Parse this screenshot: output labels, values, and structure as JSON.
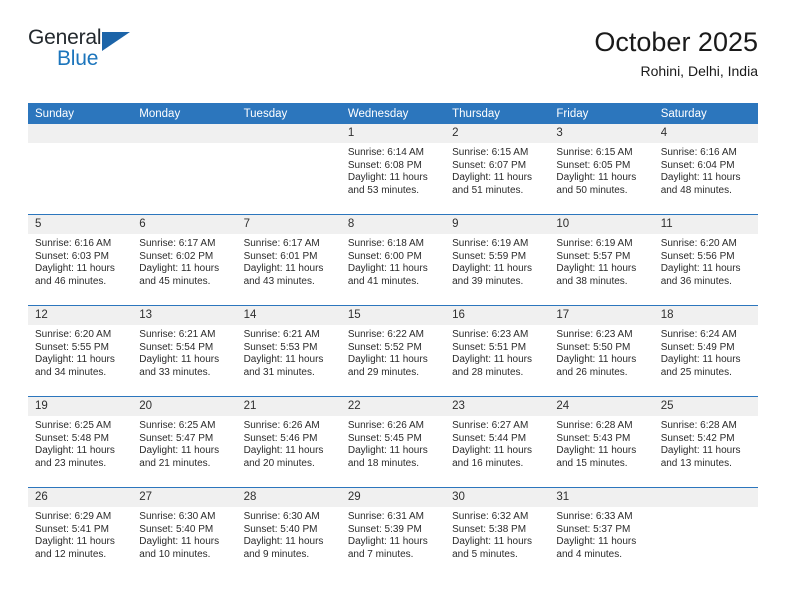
{
  "logo": {
    "word_top": "General",
    "word_bottom": "Blue",
    "triangle_color": "#1c64a8"
  },
  "header": {
    "title": "October 2025",
    "location": "Rohini, Delhi, India"
  },
  "theme": {
    "header_blue": "#2c76bd",
    "daynum_gray": "#f0f0f0"
  },
  "weekday_headers": [
    "Sunday",
    "Monday",
    "Tuesday",
    "Wednesday",
    "Thursday",
    "Friday",
    "Saturday"
  ],
  "weeks": [
    [
      {
        "day": "",
        "sunrise": "",
        "sunset": "",
        "daylight_line1": "",
        "daylight_line2": "",
        "empty": true
      },
      {
        "day": "",
        "sunrise": "",
        "sunset": "",
        "daylight_line1": "",
        "daylight_line2": "",
        "empty": true
      },
      {
        "day": "",
        "sunrise": "",
        "sunset": "",
        "daylight_line1": "",
        "daylight_line2": "",
        "empty": true
      },
      {
        "day": "1",
        "sunrise": "Sunrise: 6:14 AM",
        "sunset": "Sunset: 6:08 PM",
        "daylight_line1": "Daylight: 11 hours",
        "daylight_line2": "and 53 minutes."
      },
      {
        "day": "2",
        "sunrise": "Sunrise: 6:15 AM",
        "sunset": "Sunset: 6:07 PM",
        "daylight_line1": "Daylight: 11 hours",
        "daylight_line2": "and 51 minutes."
      },
      {
        "day": "3",
        "sunrise": "Sunrise: 6:15 AM",
        "sunset": "Sunset: 6:05 PM",
        "daylight_line1": "Daylight: 11 hours",
        "daylight_line2": "and 50 minutes."
      },
      {
        "day": "4",
        "sunrise": "Sunrise: 6:16 AM",
        "sunset": "Sunset: 6:04 PM",
        "daylight_line1": "Daylight: 11 hours",
        "daylight_line2": "and 48 minutes."
      }
    ],
    [
      {
        "day": "5",
        "sunrise": "Sunrise: 6:16 AM",
        "sunset": "Sunset: 6:03 PM",
        "daylight_line1": "Daylight: 11 hours",
        "daylight_line2": "and 46 minutes."
      },
      {
        "day": "6",
        "sunrise": "Sunrise: 6:17 AM",
        "sunset": "Sunset: 6:02 PM",
        "daylight_line1": "Daylight: 11 hours",
        "daylight_line2": "and 45 minutes."
      },
      {
        "day": "7",
        "sunrise": "Sunrise: 6:17 AM",
        "sunset": "Sunset: 6:01 PM",
        "daylight_line1": "Daylight: 11 hours",
        "daylight_line2": "and 43 minutes."
      },
      {
        "day": "8",
        "sunrise": "Sunrise: 6:18 AM",
        "sunset": "Sunset: 6:00 PM",
        "daylight_line1": "Daylight: 11 hours",
        "daylight_line2": "and 41 minutes."
      },
      {
        "day": "9",
        "sunrise": "Sunrise: 6:19 AM",
        "sunset": "Sunset: 5:59 PM",
        "daylight_line1": "Daylight: 11 hours",
        "daylight_line2": "and 39 minutes."
      },
      {
        "day": "10",
        "sunrise": "Sunrise: 6:19 AM",
        "sunset": "Sunset: 5:57 PM",
        "daylight_line1": "Daylight: 11 hours",
        "daylight_line2": "and 38 minutes."
      },
      {
        "day": "11",
        "sunrise": "Sunrise: 6:20 AM",
        "sunset": "Sunset: 5:56 PM",
        "daylight_line1": "Daylight: 11 hours",
        "daylight_line2": "and 36 minutes."
      }
    ],
    [
      {
        "day": "12",
        "sunrise": "Sunrise: 6:20 AM",
        "sunset": "Sunset: 5:55 PM",
        "daylight_line1": "Daylight: 11 hours",
        "daylight_line2": "and 34 minutes."
      },
      {
        "day": "13",
        "sunrise": "Sunrise: 6:21 AM",
        "sunset": "Sunset: 5:54 PM",
        "daylight_line1": "Daylight: 11 hours",
        "daylight_line2": "and 33 minutes."
      },
      {
        "day": "14",
        "sunrise": "Sunrise: 6:21 AM",
        "sunset": "Sunset: 5:53 PM",
        "daylight_line1": "Daylight: 11 hours",
        "daylight_line2": "and 31 minutes."
      },
      {
        "day": "15",
        "sunrise": "Sunrise: 6:22 AM",
        "sunset": "Sunset: 5:52 PM",
        "daylight_line1": "Daylight: 11 hours",
        "daylight_line2": "and 29 minutes."
      },
      {
        "day": "16",
        "sunrise": "Sunrise: 6:23 AM",
        "sunset": "Sunset: 5:51 PM",
        "daylight_line1": "Daylight: 11 hours",
        "daylight_line2": "and 28 minutes."
      },
      {
        "day": "17",
        "sunrise": "Sunrise: 6:23 AM",
        "sunset": "Sunset: 5:50 PM",
        "daylight_line1": "Daylight: 11 hours",
        "daylight_line2": "and 26 minutes."
      },
      {
        "day": "18",
        "sunrise": "Sunrise: 6:24 AM",
        "sunset": "Sunset: 5:49 PM",
        "daylight_line1": "Daylight: 11 hours",
        "daylight_line2": "and 25 minutes."
      }
    ],
    [
      {
        "day": "19",
        "sunrise": "Sunrise: 6:25 AM",
        "sunset": "Sunset: 5:48 PM",
        "daylight_line1": "Daylight: 11 hours",
        "daylight_line2": "and 23 minutes."
      },
      {
        "day": "20",
        "sunrise": "Sunrise: 6:25 AM",
        "sunset": "Sunset: 5:47 PM",
        "daylight_line1": "Daylight: 11 hours",
        "daylight_line2": "and 21 minutes."
      },
      {
        "day": "21",
        "sunrise": "Sunrise: 6:26 AM",
        "sunset": "Sunset: 5:46 PM",
        "daylight_line1": "Daylight: 11 hours",
        "daylight_line2": "and 20 minutes."
      },
      {
        "day": "22",
        "sunrise": "Sunrise: 6:26 AM",
        "sunset": "Sunset: 5:45 PM",
        "daylight_line1": "Daylight: 11 hours",
        "daylight_line2": "and 18 minutes."
      },
      {
        "day": "23",
        "sunrise": "Sunrise: 6:27 AM",
        "sunset": "Sunset: 5:44 PM",
        "daylight_line1": "Daylight: 11 hours",
        "daylight_line2": "and 16 minutes."
      },
      {
        "day": "24",
        "sunrise": "Sunrise: 6:28 AM",
        "sunset": "Sunset: 5:43 PM",
        "daylight_line1": "Daylight: 11 hours",
        "daylight_line2": "and 15 minutes."
      },
      {
        "day": "25",
        "sunrise": "Sunrise: 6:28 AM",
        "sunset": "Sunset: 5:42 PM",
        "daylight_line1": "Daylight: 11 hours",
        "daylight_line2": "and 13 minutes."
      }
    ],
    [
      {
        "day": "26",
        "sunrise": "Sunrise: 6:29 AM",
        "sunset": "Sunset: 5:41 PM",
        "daylight_line1": "Daylight: 11 hours",
        "daylight_line2": "and 12 minutes."
      },
      {
        "day": "27",
        "sunrise": "Sunrise: 6:30 AM",
        "sunset": "Sunset: 5:40 PM",
        "daylight_line1": "Daylight: 11 hours",
        "daylight_line2": "and 10 minutes."
      },
      {
        "day": "28",
        "sunrise": "Sunrise: 6:30 AM",
        "sunset": "Sunset: 5:40 PM",
        "daylight_line1": "Daylight: 11 hours",
        "daylight_line2": "and 9 minutes."
      },
      {
        "day": "29",
        "sunrise": "Sunrise: 6:31 AM",
        "sunset": "Sunset: 5:39 PM",
        "daylight_line1": "Daylight: 11 hours",
        "daylight_line2": "and 7 minutes."
      },
      {
        "day": "30",
        "sunrise": "Sunrise: 6:32 AM",
        "sunset": "Sunset: 5:38 PM",
        "daylight_line1": "Daylight: 11 hours",
        "daylight_line2": "and 5 minutes."
      },
      {
        "day": "31",
        "sunrise": "Sunrise: 6:33 AM",
        "sunset": "Sunset: 5:37 PM",
        "daylight_line1": "Daylight: 11 hours",
        "daylight_line2": "and 4 minutes."
      },
      {
        "day": "",
        "sunrise": "",
        "sunset": "",
        "daylight_line1": "",
        "daylight_line2": "",
        "empty": true
      }
    ]
  ]
}
